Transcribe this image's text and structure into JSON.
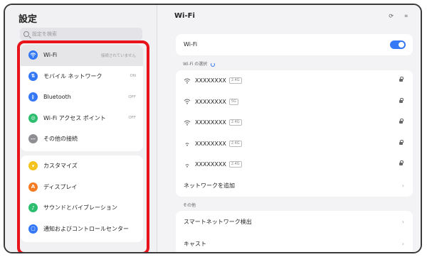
{
  "sidebar": {
    "title": "設定",
    "search_placeholder": "設定を検索",
    "group1": [
      {
        "label": "Wi-Fi",
        "value": "接続されていません",
        "icon": "wifi-icon",
        "color": "#3478f6"
      },
      {
        "label": "モバイル ネットワーク",
        "value": "ON",
        "icon": "mobile-network-icon",
        "color": "#3478f6"
      },
      {
        "label": "Bluetooth",
        "value": "OFF",
        "icon": "bluetooth-icon",
        "color": "#3478f6"
      },
      {
        "label": "Wi-Fi アクセス ポイント",
        "value": "OFF",
        "icon": "hotspot-icon",
        "color": "#2dbd6e"
      },
      {
        "label": "その他の接続",
        "value": "",
        "icon": "more-connections-icon",
        "color": "#8e8e93"
      }
    ],
    "group2": [
      {
        "label": "カスタマイズ",
        "icon": "customize-icon",
        "color": "#f5c31d"
      },
      {
        "label": "ディスプレイ",
        "icon": "display-icon",
        "color": "#f57c24"
      },
      {
        "label": "サウンドとバイブレーション",
        "icon": "sound-icon",
        "color": "#2dbd6e"
      },
      {
        "label": "通知およびコントロールセンター",
        "icon": "notification-icon",
        "color": "#3478f6"
      }
    ]
  },
  "detail": {
    "title": "Wi-Fi",
    "wifi_label": "Wi-Fi",
    "wifi_enabled": true,
    "select_section": "Wi-Fi の選択",
    "networks": [
      {
        "ssid": "XXXXXXXX",
        "band": "2.4G"
      },
      {
        "ssid": "XXXXXXXX",
        "band": "5G"
      },
      {
        "ssid": "XXXXXXXX",
        "band": "2.4G"
      },
      {
        "ssid": "XXXXXXXX",
        "band": "2.4G"
      },
      {
        "ssid": "XXXXXXXX",
        "band": "2.4G"
      }
    ],
    "add_network": "ネットワークを追加",
    "other_section": "その他",
    "other_items": [
      "スマートネットワーク検出",
      "キャスト"
    ]
  },
  "colors": {
    "highlight": "#e8131b",
    "accent": "#3478f6"
  }
}
